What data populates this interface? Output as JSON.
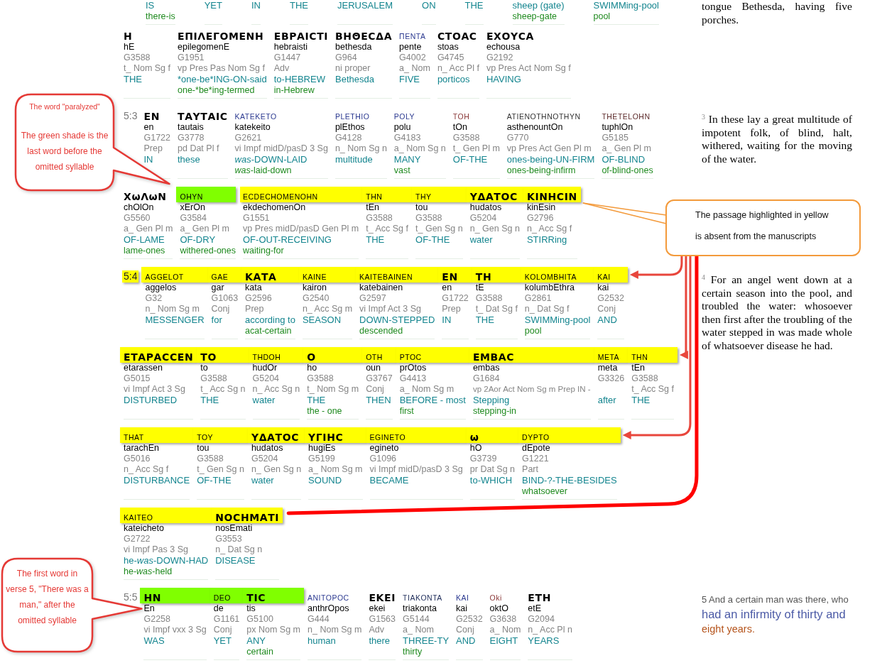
{
  "rows": [
    {
      "words": [
        {
          "gloss": "IS",
          "meaning": "there-is"
        },
        {
          "gloss": "YET"
        },
        {
          "gloss": "IN"
        },
        {
          "gloss": "THE"
        },
        {
          "gloss": "JERUSALEM"
        },
        {
          "gloss": "ON"
        },
        {
          "gloss": "THE"
        },
        {
          "gloss": "sheep (gate)",
          "meaning": "sheep-gate"
        },
        {
          "gloss": "SWIMMing-pool",
          "meaning": "pool"
        }
      ],
      "translation": {
        "kind": "kjv",
        "text": "tongue Bethesda, having five porches."
      }
    },
    {
      "words": [
        {
          "greek": {
            "text": "Η",
            "kind": "uncial"
          },
          "highlighted": false,
          "transliteration": "hE",
          "strongs": "G3588",
          "parsing": "t_ Nom Sg f",
          "gloss": "THE"
        },
        {
          "greek": {
            "text": "ΕΠΙΛΕΓΟΜΕΝΗ",
            "kind": "uncial"
          },
          "highlighted": false,
          "transliteration": "epilegomenE",
          "strongs": "G1951",
          "parsing": "vp Pres Pas Nom Sg f",
          "gloss": "*one-be*ING-ON-said",
          "meaning": "one-*be*ing-termed"
        },
        {
          "greek": {
            "text": "ΕΒΡΑΙϹΤΙ",
            "kind": "uncial"
          },
          "highlighted": false,
          "transliteration": "hebraisti",
          "strongs": "G1447",
          "parsing": "Adv",
          "gloss": "to-HEBREW",
          "meaning": "in-Hebrew"
        },
        {
          "greek": {
            "text": "ΒΗΘΕϹΔΑ",
            "kind": "uncial"
          },
          "highlighted": false,
          "transliteration": "bethesda",
          "strongs": "G964",
          "parsing": "ni proper",
          "gloss": "Bethesda"
        },
        {
          "greek": {
            "text": "ΠΕΝΤΑ",
            "kind": "label",
            "color": "#2b3990"
          },
          "highlighted": false,
          "transliteration": "pente",
          "strongs": "G4002",
          "parsing": "a_ Nom",
          "gloss": "FIVE"
        },
        {
          "greek": {
            "text": "ϹΤΟΑϹ",
            "kind": "uncial"
          },
          "highlighted": false,
          "transliteration": "stoas",
          "strongs": "G4745",
          "parsing": "n_ Acc Pl f",
          "gloss": "porticos"
        },
        {
          "greek": {
            "text": "ΕΧΟΥϹΑ",
            "kind": "uncial"
          },
          "highlighted": false,
          "transliteration": "echousa",
          "strongs": "G2192",
          "parsing": "vp Pres Act Nom Sg f",
          "gloss": "HAVING"
        }
      ]
    },
    {
      "verse": {
        "text": "5:3",
        "highlighted": false
      },
      "words": [
        {
          "greek": {
            "text": "ΕΝ",
            "kind": "uncial"
          },
          "highlighted": false,
          "transliteration": "en",
          "strongs": "G1722",
          "parsing": "Prep",
          "gloss": "IN"
        },
        {
          "greek": {
            "text": "ΤΑΥΤΑΙϹ",
            "kind": "uncial"
          },
          "highlighted": false,
          "transliteration": "tautais",
          "strongs": "G3778",
          "parsing": "pd Dat Pl f",
          "gloss": "these"
        },
        {
          "greek": {
            "text": "KATEKETO",
            "kind": "label",
            "color": "#2b3990"
          },
          "highlighted": false,
          "transliteration": "katekeito",
          "strongs": "G2621",
          "parsing": "vi Impf midD/pasD 3 Sg",
          "gloss": "*was*-DOWN-LAID",
          "meaning": "*was*-laid-down"
        },
        {
          "greek": {
            "text": "PLETHIO",
            "kind": "label",
            "color": "#2b3990"
          },
          "highlighted": false,
          "transliteration": "plEthos",
          "strongs": "G4128",
          "parsing": "n_ Nom Sg n",
          "gloss": "multitude"
        },
        {
          "greek": {
            "text": "POLY",
            "kind": "label",
            "color": "#2b3990"
          },
          "highlighted": false,
          "transliteration": "polu",
          "strongs": "G4183",
          "parsing": "a_ Nom Sg n",
          "gloss": "MANY",
          "meaning": "vast"
        },
        {
          "greek": {
            "text": "TOH",
            "kind": "label",
            "color": "#8b3a3a"
          },
          "highlighted": false,
          "transliteration": "tOn",
          "strongs": "G3588",
          "parsing": "t_ Gen Pl m",
          "gloss": "OF-THE"
        },
        {
          "greek": {
            "text": "ATIENOTHNOTHYN",
            "kind": "label",
            "color": "#333333"
          },
          "highlighted": false,
          "transliteration": "asthenountOn",
          "strongs": "G770",
          "parsing": "vp Pres Act Gen Pl m",
          "gloss": "ones-being-UN-FIRM",
          "meaning": "ones-being-infirm"
        },
        {
          "greek": {
            "text": "THETELOHN",
            "kind": "label",
            "color": "#5c2a2a"
          },
          "highlighted": false,
          "transliteration": "tuphlOn",
          "strongs": "G5185",
          "parsing": "a_ Gen Pl m",
          "gloss": "OF-BLIND",
          "meaning": "of-blind-ones"
        }
      ],
      "translation": {
        "kind": "kjv",
        "text": "$^{3}$ In these lay a great multitude of impotent folk, of blind, halt, withered, waiting for the moving of the water."
      }
    },
    {
      "words": [
        {
          "greek": {
            "text": "ΧωΛωΝ",
            "kind": "uncial"
          },
          "highlighted": false,
          "transliteration": "chOlOn",
          "strongs": "G5560",
          "parsing": "a_ Gen Pl m",
          "gloss": "OF-LAME",
          "meaning": "lame-ones"
        },
        {
          "greek": {
            "text": "OHYN",
            "kind": "label"
          },
          "highlighted": true,
          "color": "#80ff00",
          "transliteration": "xErOn",
          "strongs": "G3584",
          "parsing": "a_ Gen Pl m",
          "gloss": "OF-DRY",
          "meaning": "withered-ones"
        },
        {
          "greek": {
            "text": "ECDECHOMENOHN",
            "kind": "label"
          },
          "highlighted": true,
          "color": "#ffff00",
          "transliteration": "ekdechomenOn",
          "strongs": "G1551",
          "parsing": "vp Pres midD/pasD Gen Pl m",
          "gloss": "OF-OUT-RECEIVING",
          "meaning": "waiting-for"
        },
        {
          "greek": {
            "text": "THN",
            "kind": "label"
          },
          "highlighted": true,
          "color": "#ffff00",
          "transliteration": "tEn",
          "strongs": "G3588",
          "parsing": "t_ Acc Sg f",
          "gloss": "THE"
        },
        {
          "greek": {
            "text": "THY",
            "kind": "label"
          },
          "highlighted": true,
          "color": "#ffff00",
          "transliteration": "tou",
          "strongs": "G3588",
          "parsing": "t_ Gen Sg n",
          "gloss": "OF-THE"
        },
        {
          "greek": {
            "text": "ΥΔΑΤΟϹ",
            "kind": "uncial"
          },
          "highlighted": true,
          "color": "#ffff00",
          "transliteration": "hudatos",
          "strongs": "G5204",
          "parsing": "n_ Gen Sg n",
          "gloss": "water"
        },
        {
          "greek": {
            "text": "ΚΙΝΗϹΙΝ",
            "kind": "uncial"
          },
          "highlighted": true,
          "color": "#ffff00",
          "transliteration": "kinEsin",
          "strongs": "G2796",
          "parsing": "n_ Acc Sg f",
          "gloss": "STIRRing"
        }
      ]
    },
    {
      "verse": {
        "text": "5:4",
        "highlighted": true,
        "color": "#ffff00"
      },
      "words": [
        {
          "greek": {
            "text": "AGGELOT",
            "kind": "label"
          },
          "highlighted": true,
          "color": "#ffff00",
          "transliteration": "aggelos",
          "strongs": "G32",
          "parsing": "n_ Nom Sg m",
          "gloss": "MESSENGER"
        },
        {
          "greek": {
            "text": "GAE",
            "kind": "label"
          },
          "highlighted": true,
          "color": "#ffff00",
          "transliteration": "gar",
          "strongs": "G1063",
          "parsing": "Conj",
          "gloss": "for"
        },
        {
          "greek": {
            "text": "ΚΑΤΑ",
            "kind": "uncial"
          },
          "highlighted": true,
          "color": "#ffff00",
          "transliteration": "kata",
          "strongs": "G2596",
          "parsing": "Prep",
          "gloss": "according to",
          "meaning": "acat-certain"
        },
        {
          "greek": {
            "text": "KAINE",
            "kind": "label"
          },
          "highlighted": true,
          "color": "#ffff00",
          "transliteration": "kairon",
          "strongs": "G2540",
          "parsing": "n_ Acc Sg m",
          "gloss": "SEASON"
        },
        {
          "greek": {
            "text": "KAITEBAINEN",
            "kind": "label"
          },
          "highlighted": true,
          "color": "#ffff00",
          "transliteration": "katebainen",
          "strongs": "G2597",
          "parsing": "vi Impf Act 3 Sg",
          "gloss": "DOWN-STEPPED",
          "meaning": "descended"
        },
        {
          "greek": {
            "text": "ΕΝ",
            "kind": "uncial"
          },
          "highlighted": true,
          "color": "#ffff00",
          "transliteration": "en",
          "strongs": "G1722",
          "parsing": "Prep",
          "gloss": "IN"
        },
        {
          "greek": {
            "text": "ΤΗ",
            "kind": "uncial"
          },
          "highlighted": true,
          "color": "#ffff00",
          "transliteration": "tE",
          "strongs": "G3588",
          "parsing": "t_ Dat Sg f",
          "gloss": "THE"
        },
        {
          "greek": {
            "text": "KOLOMBHITA",
            "kind": "label"
          },
          "highlighted": true,
          "color": "#ffff00",
          "transliteration": "kolumbEthra",
          "strongs": "G2861",
          "parsing": "n_ Dat Sg f",
          "gloss": "SWIMMing-pool",
          "meaning": "pool"
        },
        {
          "greek": {
            "text": "KAI",
            "kind": "label"
          },
          "highlighted": true,
          "color": "#ffff00",
          "transliteration": "kai",
          "strongs": "G2532",
          "parsing": "Conj",
          "gloss": "AND"
        }
      ],
      "translation": {
        "kind": "kjv",
        "text": "$^{4}$ For an angel went down at a certain season into the pool, and troubled the water: whosoever then first after the troubling of the water stepped in was made whole of whatsoever disease he had."
      }
    },
    {
      "words": [
        {
          "greek": {
            "text": "ΕΤΑΡΑϹϹΕΝ",
            "kind": "uncial"
          },
          "highlighted": true,
          "color": "#ffff00",
          "transliteration": "etarassen",
          "strongs": "G5015",
          "parsing": "vi Impf Act 3 Sg",
          "gloss": "DISTURBED"
        },
        {
          "greek": {
            "text": "ΤΟ",
            "kind": "uncial"
          },
          "highlighted": true,
          "color": "#ffff00",
          "transliteration": "to",
          "strongs": "G3588",
          "parsing": "t_ Acc Sg n",
          "gloss": "THE"
        },
        {
          "greek": {
            "text": "THDOH",
            "kind": "label"
          },
          "highlighted": true,
          "color": "#ffff00",
          "transliteration": "hudOr",
          "strongs": "G5204",
          "parsing": "n_ Acc Sg n",
          "gloss": "water"
        },
        {
          "greek": {
            "text": "Ο",
            "kind": "uncial"
          },
          "highlighted": true,
          "color": "#ffff00",
          "transliteration": "ho",
          "strongs": "G3588",
          "parsing": "t_ Nom Sg m",
          "gloss": "THE",
          "meaning": "the - one"
        },
        {
          "greek": {
            "text": "OTH",
            "kind": "label"
          },
          "highlighted": true,
          "color": "#ffff00",
          "transliteration": "oun",
          "strongs": "G3767",
          "parsing": "Conj",
          "gloss": "THEN"
        },
        {
          "greek": {
            "text": "PTOC",
            "kind": "label"
          },
          "highlighted": true,
          "color": "#ffff00",
          "transliteration": "prOtos",
          "strongs": "G4413",
          "parsing": "a_ Nom Sg m",
          "gloss": "BEFORE - most",
          "meaning": "first"
        },
        {
          "greek": {
            "text": "ΕΜΒΑϹ",
            "kind": "uncial"
          },
          "highlighted": true,
          "color": "#ffff00",
          "transliteration": "embas",
          "strongs": "G1684",
          "parsing": "vp 2Aor Act Nom Sg m Prep IN -",
          "gloss": "Stepping",
          "meaning": "stepping-in"
        },
        {
          "greek": {
            "text": "META",
            "kind": "label"
          },
          "highlighted": true,
          "color": "#ffff00",
          "transliteration": "meta",
          "strongs": "G3326",
          "gloss": "after"
        },
        {
          "greek": {
            "text": "THN",
            "kind": "label"
          },
          "highlighted": true,
          "color": "#ffff00",
          "transliteration": "tEn",
          "strongs": "G3588",
          "parsing": "t_ Acc Sg f",
          "gloss": "THE"
        }
      ]
    },
    {
      "words": [
        {
          "greek": {
            "text": "THAT",
            "kind": "label"
          },
          "highlighted": true,
          "color": "#ffff00",
          "transliteration": "tarachEn",
          "strongs": "G5016",
          "parsing": "n_ Acc Sg f",
          "gloss": "DISTURBANCE"
        },
        {
          "greek": {
            "text": "TOY",
            "kind": "label"
          },
          "highlighted": true,
          "color": "#ffff00",
          "transliteration": "tou",
          "strongs": "G3588",
          "parsing": "t_ Gen Sg n",
          "gloss": "OF-THE"
        },
        {
          "greek": {
            "text": "ΥΔΑΤΟϹ",
            "kind": "uncial"
          },
          "highlighted": true,
          "color": "#ffff00",
          "transliteration": "hudatos",
          "strongs": "G5204",
          "parsing": "n_ Gen Sg n",
          "gloss": "water"
        },
        {
          "greek": {
            "text": "ΥΓΙΗϹ",
            "kind": "uncial"
          },
          "highlighted": true,
          "color": "#ffff00",
          "transliteration": "hugiEs",
          "strongs": "G5199",
          "parsing": "a_ Nom Sg m",
          "gloss": "SOUND"
        },
        {
          "greek": {
            "text": "EGINETO",
            "kind": "label"
          },
          "highlighted": true,
          "color": "#ffff00",
          "transliteration": "egineto",
          "strongs": "G1096",
          "parsing": "vi Impf midD/pasD 3 Sg",
          "gloss": "BECAME"
        },
        {
          "greek": {
            "text": "ω",
            "kind": "uncial"
          },
          "highlighted": true,
          "color": "#ffff00",
          "transliteration": "hO",
          "strongs": "G3739",
          "parsing": "pr Dat Sg n",
          "gloss": "to-WHICH"
        },
        {
          "greek": {
            "text": "DYPTO",
            "kind": "label"
          },
          "highlighted": true,
          "color": "#ffff00",
          "transliteration": "dEpote",
          "strongs": "G1221",
          "parsing": "Part",
          "gloss": "BIND-?-THE-BESIDES",
          "meaning": "whatsoever"
        }
      ]
    },
    {
      "words": [
        {
          "greek": {
            "text": "KAITEO",
            "kind": "label"
          },
          "highlighted": true,
          "color": "#ffff00",
          "transliteration": "kateicheto",
          "strongs": "G2722",
          "parsing": "vi Impf Pas 3 Sg",
          "gloss": "he-*was*-DOWN-HAD",
          "meaning": "he-*was*-held"
        },
        {
          "greek": {
            "text": "ΝΟϹΗΜΑΤΙ",
            "kind": "uncial"
          },
          "highlighted": true,
          "color": "#ffff00",
          "transliteration": "nosEmati",
          "strongs": "G3553",
          "parsing": "n_ Dat Sg n",
          "gloss": "DISEASE"
        }
      ]
    },
    {
      "verse": {
        "text": "5:5",
        "highlighted": false
      },
      "words": [
        {
          "greek": {
            "text": "ΗΝ",
            "kind": "uncial"
          },
          "highlighted": true,
          "color": "#80ff00",
          "transliteration": "En",
          "strongs": "G2258",
          "parsing": "vi Impf vxx 3 Sg",
          "gloss": "WAS"
        },
        {
          "greek": {
            "text": "DEO",
            "kind": "label"
          },
          "highlighted": true,
          "color": "#80ff00",
          "transliteration": "de",
          "strongs": "G1161",
          "parsing": "Conj",
          "gloss": "YET"
        },
        {
          "greek": {
            "text": "ΤΙϹ",
            "kind": "uncial"
          },
          "highlighted": true,
          "color": "#80ff00",
          "transliteration": "tis",
          "strongs": "G5100",
          "parsing": "px Nom Sg m",
          "gloss": "ANY",
          "meaning": "certain"
        },
        {
          "greek": {
            "text": "ANITOPOC",
            "kind": "label",
            "color": "#2b3990"
          },
          "highlighted": false,
          "transliteration": "anthrOpos",
          "strongs": "G444",
          "parsing": "n_ Nom Sg m",
          "gloss": "human"
        },
        {
          "greek": {
            "text": "ΕΚΕΙ",
            "kind": "uncial"
          },
          "highlighted": false,
          "transliteration": "ekei",
          "strongs": "G1563",
          "parsing": "Adv",
          "gloss": "there"
        },
        {
          "greek": {
            "text": "TIAKONTA",
            "kind": "label",
            "color": "#1f2d5a"
          },
          "highlighted": false,
          "transliteration": "triakonta",
          "strongs": "G5144",
          "parsing": "a_ Nom",
          "gloss": "THREE-TY",
          "meaning": "thirty"
        },
        {
          "greek": {
            "text": "KAI",
            "kind": "label",
            "color": "#2b3990"
          },
          "highlighted": false,
          "transliteration": "kai",
          "strongs": "G2532",
          "parsing": "Conj",
          "gloss": "AND"
        },
        {
          "greek": {
            "text": "Oki",
            "kind": "label",
            "color": "#8b3a3a"
          },
          "highlighted": false,
          "transliteration": "oktO",
          "strongs": "G3638",
          "parsing": "a_ Nom",
          "gloss": "EIGHT"
        },
        {
          "greek": {
            "text": "ΕΤΗ",
            "kind": "uncial"
          },
          "highlighted": false,
          "transliteration": "etE",
          "strongs": "G2094",
          "parsing": "n_ Acc Pl n",
          "gloss": "YEARS"
        }
      ],
      "translation": {
        "kind": "paraphrase",
        "segments": [
          {
            "text": "5 And a certain man was there, who",
            "color": "#555555"
          },
          {
            "text": "had an infirmity of thirty and",
            "color": "#4b5aa6"
          },
          {
            "text": "eight years.",
            "color": "#b5541c"
          }
        ]
      }
    }
  ],
  "callouts": [
    {
      "kind": "bubble",
      "texts": [
        "The word \"paralyzed\"",
        "The green shade is the last word before the omitted syllable"
      ]
    },
    {
      "kind": "note",
      "texts": [
        "The passage highlighted in yellow is absent from the manuscripts"
      ]
    },
    {
      "kind": "bubble",
      "texts": [
        "The first word in verse 5, \"There was a man,\" after the omitted syllable"
      ]
    }
  ]
}
